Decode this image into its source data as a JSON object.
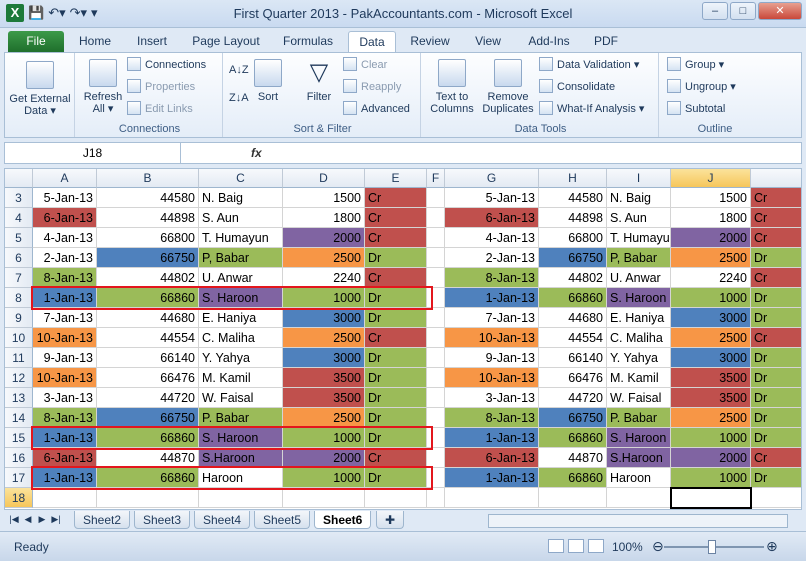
{
  "window": {
    "title": "First Quarter 2013 - PakAccountants.com - Microsoft Excel"
  },
  "tabs": [
    "File",
    "Home",
    "Insert",
    "Page Layout",
    "Formulas",
    "Data",
    "Review",
    "View",
    "Add-Ins",
    "PDF"
  ],
  "ribbon": {
    "get_external": "Get External\nData ▾",
    "refresh": "Refresh\nAll ▾",
    "connections_items": [
      "Connections",
      "Properties",
      "Edit Links"
    ],
    "connections_label": "Connections",
    "sort": "Sort",
    "filter": "Filter",
    "filter_items": [
      "Clear",
      "Reapply",
      "Advanced"
    ],
    "sortfilter_label": "Sort & Filter",
    "text_to_columns": "Text to\nColumns",
    "remove_duplicates": "Remove\nDuplicates",
    "datatools_items": [
      "Data Validation ▾",
      "Consolidate",
      "What-If Analysis ▾"
    ],
    "datatools_label": "Data Tools",
    "outline_items": [
      "Group ▾",
      "Ungroup ▾",
      "Subtotal"
    ],
    "outline_label": "Outline"
  },
  "namebox": "J18",
  "fx": "fx",
  "columns": [
    "A",
    "B",
    "C",
    "D",
    "E",
    "F",
    "G",
    "H",
    "I",
    "J"
  ],
  "rows": [
    3,
    4,
    5,
    6,
    7,
    8,
    9,
    10,
    11,
    12,
    13,
    14,
    15,
    16,
    17,
    18
  ],
  "left_table": [
    [
      "5-Jan-13",
      "44580",
      "N. Baig",
      "1500",
      "Cr"
    ],
    [
      "6-Jan-13",
      "44898",
      "S. Aun",
      "1800",
      "Cr"
    ],
    [
      "4-Jan-13",
      "66800",
      "T. Humayun",
      "2000",
      "Cr"
    ],
    [
      "2-Jan-13",
      "66750",
      "P, Babar",
      "2500",
      "Dr"
    ],
    [
      "8-Jan-13",
      "44802",
      "U. Anwar",
      "2240",
      "Cr"
    ],
    [
      "1-Jan-13",
      "66860",
      "S. Haroon",
      "1000",
      "Dr"
    ],
    [
      "7-Jan-13",
      "44680",
      "E. Haniya",
      "3000",
      "Dr"
    ],
    [
      "10-Jan-13",
      "44554",
      "C. Maliha",
      "2500",
      "Cr"
    ],
    [
      "9-Jan-13",
      "66140",
      "Y. Yahya",
      "3000",
      "Dr"
    ],
    [
      "10-Jan-13",
      "66476",
      "M. Kamil",
      "3500",
      "Dr"
    ],
    [
      "3-Jan-13",
      "44720",
      "W. Faisal",
      "3500",
      "Dr"
    ],
    [
      "8-Jan-13",
      "66750",
      "P. Babar",
      "2500",
      "Dr"
    ],
    [
      "1-Jan-13",
      "66860",
      "S. Haroon",
      "1000",
      "Dr"
    ],
    [
      "6-Jan-13",
      "44870",
      "S.Haroon",
      "2000",
      "Cr"
    ],
    [
      "1-Jan-13",
      "66860",
      "Haroon",
      "1000",
      "Dr"
    ]
  ],
  "right_table": [
    [
      "5-Jan-13",
      "44580",
      "N. Baig",
      "1500",
      "Cr"
    ],
    [
      "6-Jan-13",
      "44898",
      "S. Aun",
      "1800",
      "Cr"
    ],
    [
      "4-Jan-13",
      "66800",
      "T. Humayun",
      "2000",
      "Cr"
    ],
    [
      "2-Jan-13",
      "66750",
      "P, Babar",
      "2500",
      "Dr"
    ],
    [
      "8-Jan-13",
      "44802",
      "U. Anwar",
      "2240",
      "Cr"
    ],
    [
      "1-Jan-13",
      "66860",
      "S. Haroon",
      "1000",
      "Dr"
    ],
    [
      "7-Jan-13",
      "44680",
      "E. Haniya",
      "3000",
      "Dr"
    ],
    [
      "10-Jan-13",
      "44554",
      "C. Maliha",
      "2500",
      "Cr"
    ],
    [
      "9-Jan-13",
      "66140",
      "Y. Yahya",
      "3000",
      "Dr"
    ],
    [
      "10-Jan-13",
      "66476",
      "M. Kamil",
      "3500",
      "Dr"
    ],
    [
      "3-Jan-13",
      "44720",
      "W. Faisal",
      "3500",
      "Dr"
    ],
    [
      "8-Jan-13",
      "66750",
      "P. Babar",
      "2500",
      "Dr"
    ],
    [
      "1-Jan-13",
      "66860",
      "S. Haroon",
      "1000",
      "Dr"
    ],
    [
      "6-Jan-13",
      "44870",
      "S.Haroon",
      "2000",
      "Cr"
    ],
    [
      "1-Jan-13",
      "66860",
      "Haroon",
      "1000",
      "Dr"
    ]
  ],
  "fills": {
    "A": [
      "#fff",
      "#c0504d",
      "#fff",
      "#fff",
      "#9bbb59",
      "#4f81bd",
      "#fff",
      "#f79646",
      "#fff",
      "#f79646",
      "#fff",
      "#9bbb59",
      "#4f81bd",
      "#c0504d",
      "#4f81bd"
    ],
    "B": [
      "#fff",
      "#fff",
      "#fff",
      "#4f81bd",
      "#fff",
      "#9bbb59",
      "#fff",
      "#fff",
      "#fff",
      "#fff",
      "#fff",
      "#4f81bd",
      "#9bbb59",
      "#fff",
      "#9bbb59"
    ],
    "C": [
      "#fff",
      "#fff",
      "#fff",
      "#9bbb59",
      "#fff",
      "#8064a2",
      "#fff",
      "#fff",
      "#fff",
      "#fff",
      "#fff",
      "#9bbb59",
      "#8064a2",
      "#8064a2",
      "#fff"
    ],
    "D": [
      "#fff",
      "#fff",
      "#8064a2",
      "#f79646",
      "#fff",
      "#9bbb59",
      "#4f81bd",
      "#f79646",
      "#4f81bd",
      "#c0504d",
      "#c0504d",
      "#f79646",
      "#9bbb59",
      "#8064a2",
      "#9bbb59"
    ],
    "E": [
      "#c0504d",
      "#c0504d",
      "#c0504d",
      "#9bbb59",
      "#c0504d",
      "#9bbb59",
      "#9bbb59",
      "#c0504d",
      "#9bbb59",
      "#9bbb59",
      "#9bbb59",
      "#9bbb59",
      "#9bbb59",
      "#c0504d",
      "#9bbb59"
    ]
  },
  "sheet_tabs": [
    "Sheet2",
    "Sheet3",
    "Sheet4",
    "Sheet5",
    "Sheet6"
  ],
  "active_sheet": "Sheet6",
  "status": {
    "ready": "Ready",
    "zoom": "100%"
  }
}
